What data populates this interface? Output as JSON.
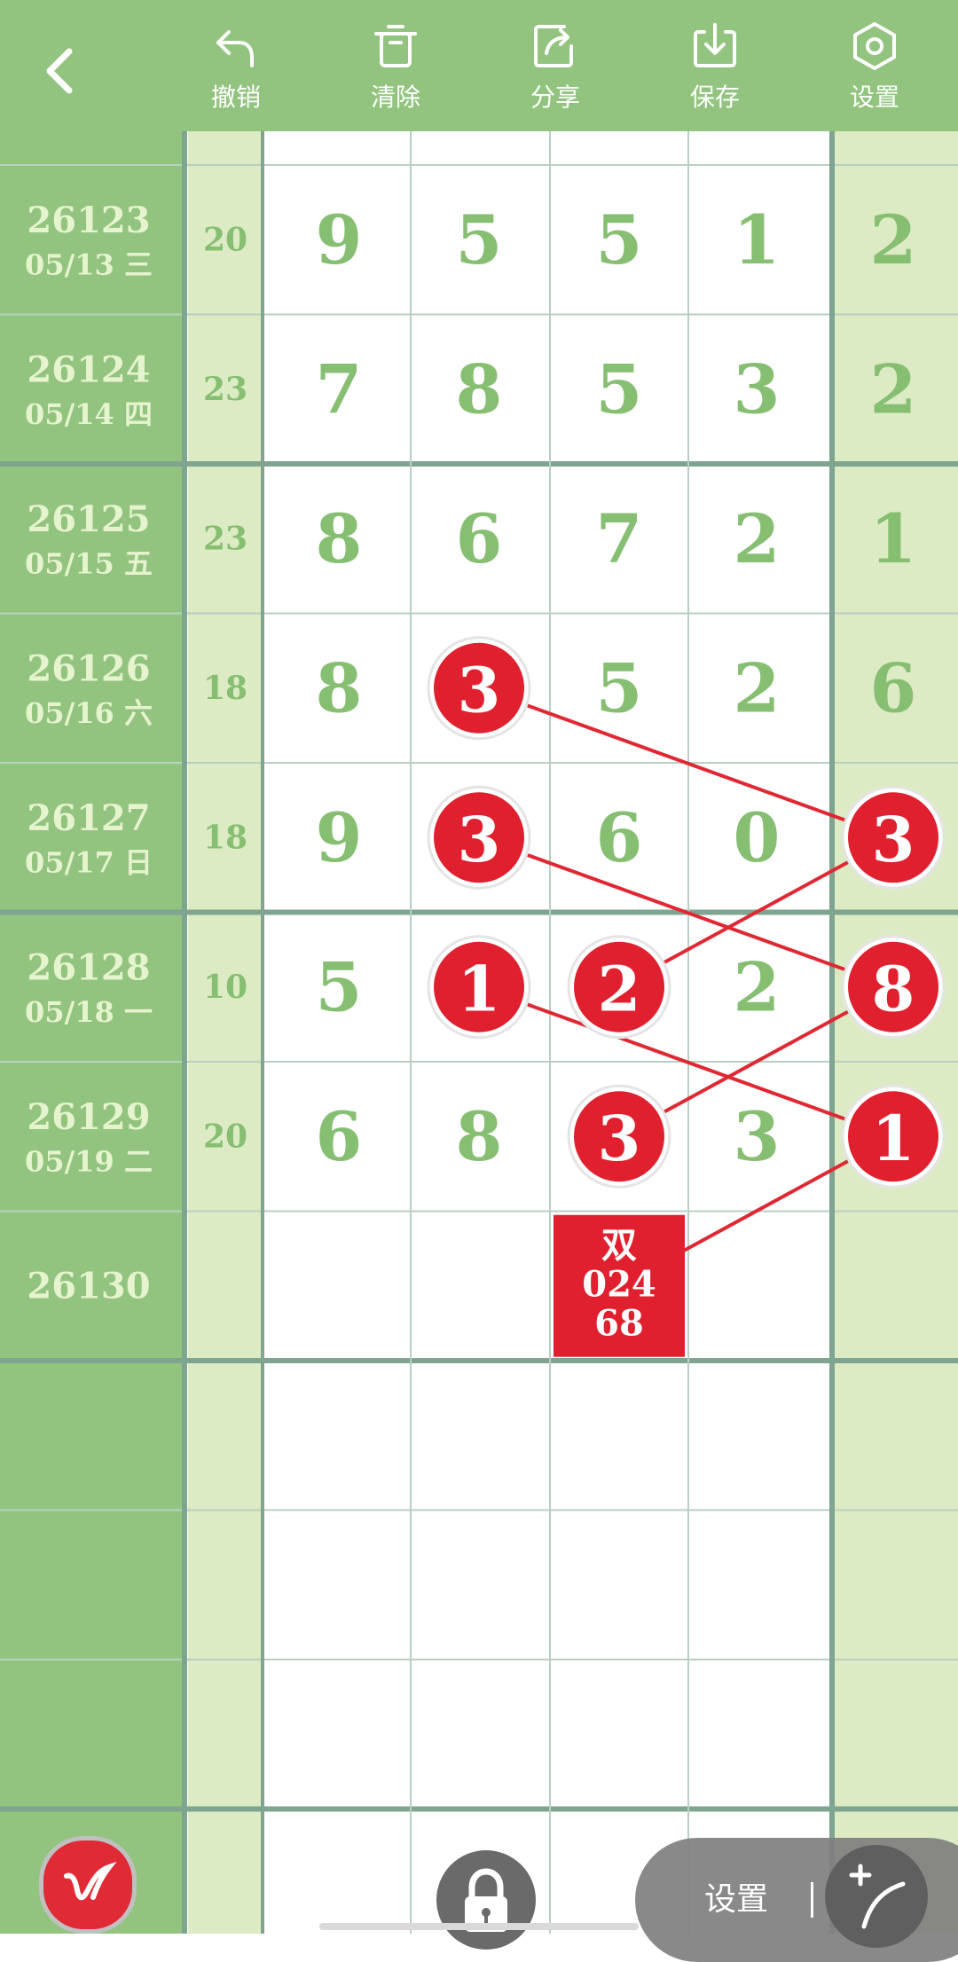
{
  "toolbar": {
    "back_icon": "chevron-left-icon",
    "buttons": [
      {
        "id": "undo",
        "label": "撤销",
        "icon": "undo-icon"
      },
      {
        "id": "clear",
        "label": "清除",
        "icon": "trash-icon"
      },
      {
        "id": "share",
        "label": "分享",
        "icon": "share-icon"
      },
      {
        "id": "save",
        "label": "保存",
        "icon": "download-icon"
      },
      {
        "id": "settings",
        "label": "设置",
        "icon": "hexagon-gear-icon"
      }
    ]
  },
  "colors": {
    "toolbar_bg": "#92c47f",
    "issue_col_bg": "#92c47f",
    "issue_text": "#e6f3cf",
    "sum_col_bg": "#dcebc3",
    "last_col_bg": "#dcebc3",
    "digit_text": "#86be72",
    "grid_line": "#b9cfc2",
    "group_line": "#7fa48f",
    "ball": "#e0202e",
    "connector": "#df2833"
  },
  "rows": [
    {
      "issue": "26123",
      "date": "05/13 三",
      "sum": "20",
      "digits": [
        "9",
        "5",
        "5",
        "1",
        "2"
      ]
    },
    {
      "issue": "26124",
      "date": "05/14 四",
      "sum": "23",
      "digits": [
        "7",
        "8",
        "5",
        "3",
        "2"
      ]
    },
    {
      "issue": "26125",
      "date": "05/15 五",
      "sum": "23",
      "digits": [
        "8",
        "6",
        "7",
        "2",
        "1"
      ]
    },
    {
      "issue": "26126",
      "date": "05/16 六",
      "sum": "18",
      "digits": [
        "8",
        "3",
        "5",
        "2",
        "6"
      ]
    },
    {
      "issue": "26127",
      "date": "05/17 日",
      "sum": "18",
      "digits": [
        "9",
        "3",
        "6",
        "0",
        "3"
      ]
    },
    {
      "issue": "26128",
      "date": "05/18 一",
      "sum": "10",
      "digits": [
        "5",
        "1",
        "2",
        "2",
        "8"
      ]
    },
    {
      "issue": "26129",
      "date": "05/19 二",
      "sum": "20",
      "digits": [
        "6",
        "8",
        "3",
        "3",
        "1"
      ]
    },
    {
      "issue": "26130",
      "date": "",
      "sum": "",
      "digits": [
        "",
        "",
        "",
        "",
        ""
      ]
    },
    {
      "issue": "",
      "date": "",
      "sum": "",
      "digits": [
        "",
        "",
        "",
        "",
        ""
      ]
    },
    {
      "issue": "",
      "date": "",
      "sum": "",
      "digits": [
        "",
        "",
        "",
        "",
        ""
      ]
    },
    {
      "issue": "",
      "date": "",
      "sum": "",
      "digits": [
        "",
        "",
        "",
        "",
        ""
      ]
    },
    {
      "issue": "",
      "date": "",
      "sum": "",
      "digits": [
        "",
        "",
        "",
        "",
        ""
      ]
    }
  ],
  "circled": [
    {
      "row": 3,
      "col": 1,
      "value": "3"
    },
    {
      "row": 4,
      "col": 1,
      "value": "3"
    },
    {
      "row": 4,
      "col": 4,
      "value": "3"
    },
    {
      "row": 5,
      "col": 1,
      "value": "1"
    },
    {
      "row": 5,
      "col": 2,
      "value": "2"
    },
    {
      "row": 5,
      "col": 4,
      "value": "8"
    },
    {
      "row": 6,
      "col": 2,
      "value": "3"
    },
    {
      "row": 6,
      "col": 4,
      "value": "1"
    }
  ],
  "connectors": [
    {
      "from": [
        3,
        1
      ],
      "to": [
        4,
        4
      ]
    },
    {
      "from": [
        4,
        1
      ],
      "to": [
        5,
        4
      ]
    },
    {
      "from": [
        4,
        4
      ],
      "to": [
        5,
        2
      ]
    },
    {
      "from": [
        5,
        1
      ],
      "to": [
        6,
        4
      ]
    },
    {
      "from": [
        5,
        4
      ],
      "to": [
        6,
        2
      ]
    },
    {
      "from": [
        6,
        4
      ],
      "to": [
        7,
        2
      ]
    }
  ],
  "prediction": {
    "row": 7,
    "col": 2,
    "lines": [
      "双",
      "024",
      "68"
    ]
  },
  "bottom_controls": {
    "pen_icon": "pen-signature-icon",
    "lock_icon": "lock-icon",
    "settings_label": "设置",
    "draw_icon": "draw-line-icon"
  }
}
